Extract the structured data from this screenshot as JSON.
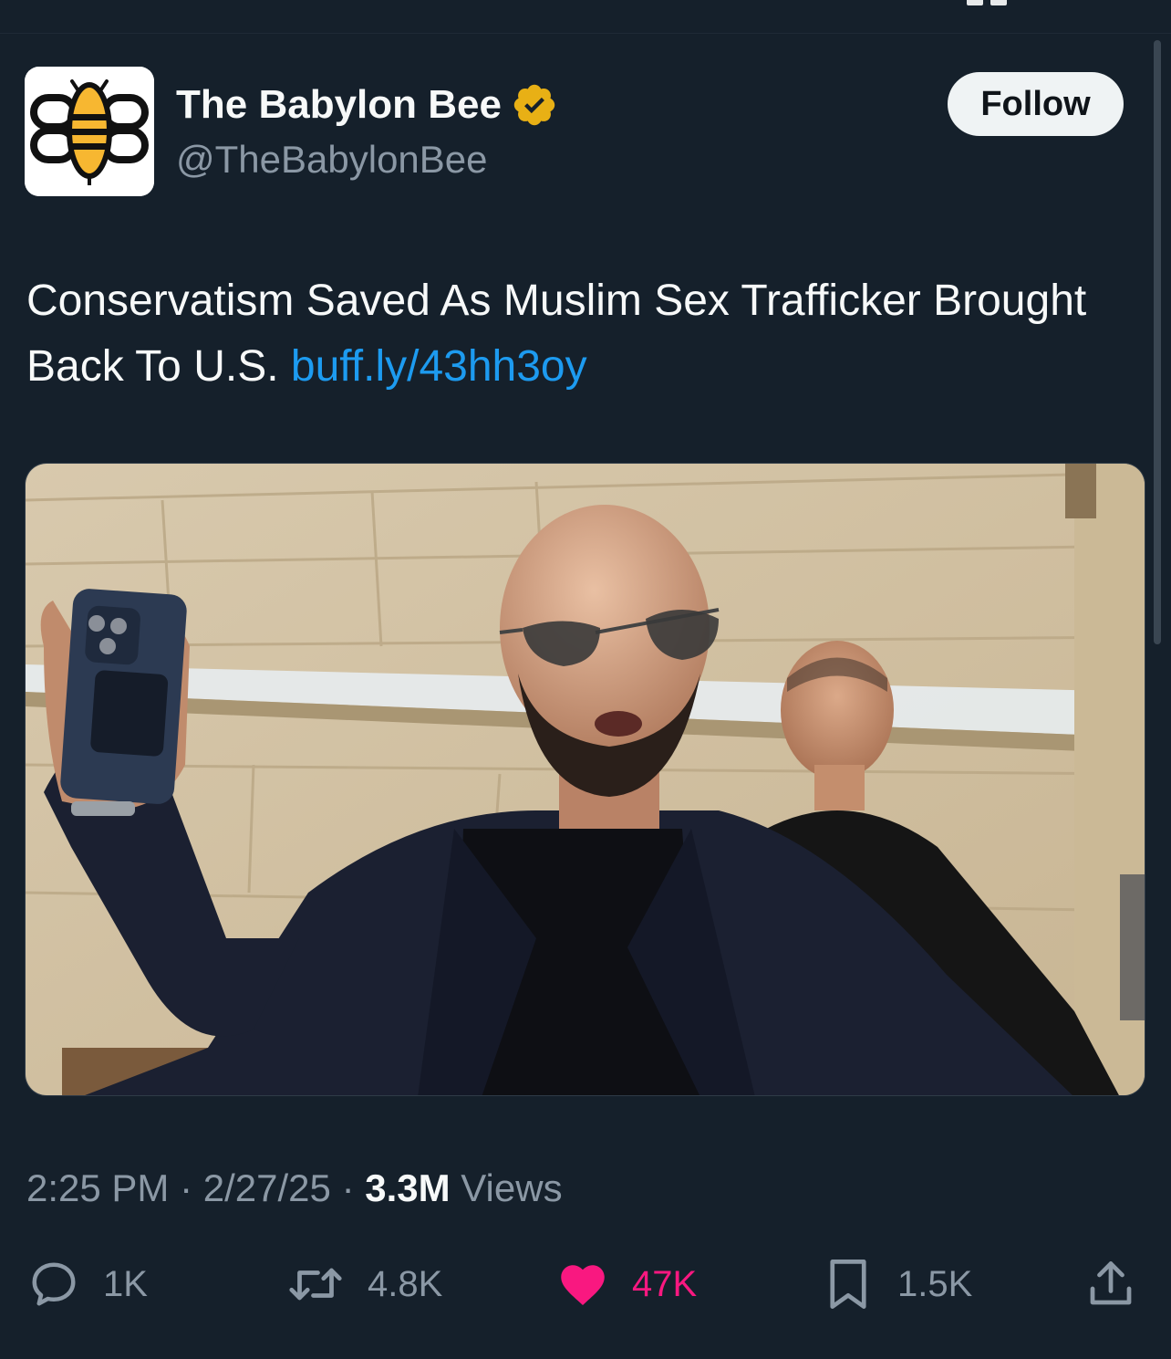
{
  "author": {
    "display_name": "The Babylon Bee",
    "handle": "@TheBabylonBee",
    "verified_badge_color": "#e8b015",
    "verified_icon": "verified-badge-icon"
  },
  "follow_button": {
    "label": "Follow"
  },
  "tweet": {
    "text": "Conservatism Saved As Muslim Sex Trafficker Brought Back To U.S.",
    "link": "buff.ly/43hh3oy"
  },
  "media": {
    "type": "photo",
    "alt_description": "Bald man in sunglasses and dark jacket raising a phone, another man behind him"
  },
  "meta": {
    "time": "2:25 PM",
    "sep1": "·",
    "date": "2/27/25",
    "sep2": "·",
    "views_count": "3.3M",
    "views_label": "Views"
  },
  "actions": {
    "reply": {
      "icon": "reply-icon",
      "count": "1K"
    },
    "retweet": {
      "icon": "retweet-icon",
      "count": "4.8K"
    },
    "like": {
      "icon": "heart-icon",
      "count": "47K",
      "active": true,
      "color": "#f91880"
    },
    "bookmark": {
      "icon": "bookmark-icon",
      "count": "1.5K"
    },
    "share": {
      "icon": "share-icon"
    }
  },
  "colors": {
    "background": "#15202b",
    "text": "#f7f9f9",
    "muted": "#8b98a5",
    "link": "#1d9bf0",
    "like": "#f91880"
  }
}
